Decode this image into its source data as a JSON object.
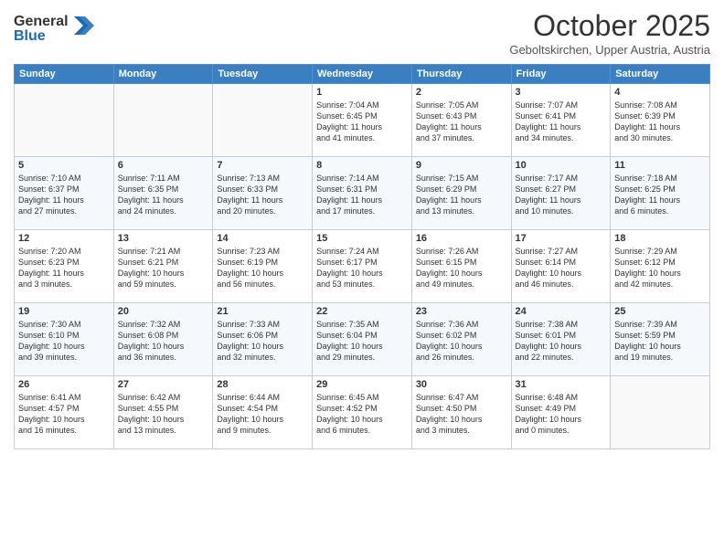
{
  "header": {
    "logo_line1": "General",
    "logo_line2": "Blue",
    "month_year": "October 2025",
    "location": "Geboltskirchen, Upper Austria, Austria"
  },
  "weekdays": [
    "Sunday",
    "Monday",
    "Tuesday",
    "Wednesday",
    "Thursday",
    "Friday",
    "Saturday"
  ],
  "weeks": [
    [
      {
        "day": "",
        "info": ""
      },
      {
        "day": "",
        "info": ""
      },
      {
        "day": "",
        "info": ""
      },
      {
        "day": "1",
        "info": "Sunrise: 7:04 AM\nSunset: 6:45 PM\nDaylight: 11 hours\nand 41 minutes."
      },
      {
        "day": "2",
        "info": "Sunrise: 7:05 AM\nSunset: 6:43 PM\nDaylight: 11 hours\nand 37 minutes."
      },
      {
        "day": "3",
        "info": "Sunrise: 7:07 AM\nSunset: 6:41 PM\nDaylight: 11 hours\nand 34 minutes."
      },
      {
        "day": "4",
        "info": "Sunrise: 7:08 AM\nSunset: 6:39 PM\nDaylight: 11 hours\nand 30 minutes."
      }
    ],
    [
      {
        "day": "5",
        "info": "Sunrise: 7:10 AM\nSunset: 6:37 PM\nDaylight: 11 hours\nand 27 minutes."
      },
      {
        "day": "6",
        "info": "Sunrise: 7:11 AM\nSunset: 6:35 PM\nDaylight: 11 hours\nand 24 minutes."
      },
      {
        "day": "7",
        "info": "Sunrise: 7:13 AM\nSunset: 6:33 PM\nDaylight: 11 hours\nand 20 minutes."
      },
      {
        "day": "8",
        "info": "Sunrise: 7:14 AM\nSunset: 6:31 PM\nDaylight: 11 hours\nand 17 minutes."
      },
      {
        "day": "9",
        "info": "Sunrise: 7:15 AM\nSunset: 6:29 PM\nDaylight: 11 hours\nand 13 minutes."
      },
      {
        "day": "10",
        "info": "Sunrise: 7:17 AM\nSunset: 6:27 PM\nDaylight: 11 hours\nand 10 minutes."
      },
      {
        "day": "11",
        "info": "Sunrise: 7:18 AM\nSunset: 6:25 PM\nDaylight: 11 hours\nand 6 minutes."
      }
    ],
    [
      {
        "day": "12",
        "info": "Sunrise: 7:20 AM\nSunset: 6:23 PM\nDaylight: 11 hours\nand 3 minutes."
      },
      {
        "day": "13",
        "info": "Sunrise: 7:21 AM\nSunset: 6:21 PM\nDaylight: 10 hours\nand 59 minutes."
      },
      {
        "day": "14",
        "info": "Sunrise: 7:23 AM\nSunset: 6:19 PM\nDaylight: 10 hours\nand 56 minutes."
      },
      {
        "day": "15",
        "info": "Sunrise: 7:24 AM\nSunset: 6:17 PM\nDaylight: 10 hours\nand 53 minutes."
      },
      {
        "day": "16",
        "info": "Sunrise: 7:26 AM\nSunset: 6:15 PM\nDaylight: 10 hours\nand 49 minutes."
      },
      {
        "day": "17",
        "info": "Sunrise: 7:27 AM\nSunset: 6:14 PM\nDaylight: 10 hours\nand 46 minutes."
      },
      {
        "day": "18",
        "info": "Sunrise: 7:29 AM\nSunset: 6:12 PM\nDaylight: 10 hours\nand 42 minutes."
      }
    ],
    [
      {
        "day": "19",
        "info": "Sunrise: 7:30 AM\nSunset: 6:10 PM\nDaylight: 10 hours\nand 39 minutes."
      },
      {
        "day": "20",
        "info": "Sunrise: 7:32 AM\nSunset: 6:08 PM\nDaylight: 10 hours\nand 36 minutes."
      },
      {
        "day": "21",
        "info": "Sunrise: 7:33 AM\nSunset: 6:06 PM\nDaylight: 10 hours\nand 32 minutes."
      },
      {
        "day": "22",
        "info": "Sunrise: 7:35 AM\nSunset: 6:04 PM\nDaylight: 10 hours\nand 29 minutes."
      },
      {
        "day": "23",
        "info": "Sunrise: 7:36 AM\nSunset: 6:02 PM\nDaylight: 10 hours\nand 26 minutes."
      },
      {
        "day": "24",
        "info": "Sunrise: 7:38 AM\nSunset: 6:01 PM\nDaylight: 10 hours\nand 22 minutes."
      },
      {
        "day": "25",
        "info": "Sunrise: 7:39 AM\nSunset: 5:59 PM\nDaylight: 10 hours\nand 19 minutes."
      }
    ],
    [
      {
        "day": "26",
        "info": "Sunrise: 6:41 AM\nSunset: 4:57 PM\nDaylight: 10 hours\nand 16 minutes."
      },
      {
        "day": "27",
        "info": "Sunrise: 6:42 AM\nSunset: 4:55 PM\nDaylight: 10 hours\nand 13 minutes."
      },
      {
        "day": "28",
        "info": "Sunrise: 6:44 AM\nSunset: 4:54 PM\nDaylight: 10 hours\nand 9 minutes."
      },
      {
        "day": "29",
        "info": "Sunrise: 6:45 AM\nSunset: 4:52 PM\nDaylight: 10 hours\nand 6 minutes."
      },
      {
        "day": "30",
        "info": "Sunrise: 6:47 AM\nSunset: 4:50 PM\nDaylight: 10 hours\nand 3 minutes."
      },
      {
        "day": "31",
        "info": "Sunrise: 6:48 AM\nSunset: 4:49 PM\nDaylight: 10 hours\nand 0 minutes."
      },
      {
        "day": "",
        "info": ""
      }
    ]
  ]
}
